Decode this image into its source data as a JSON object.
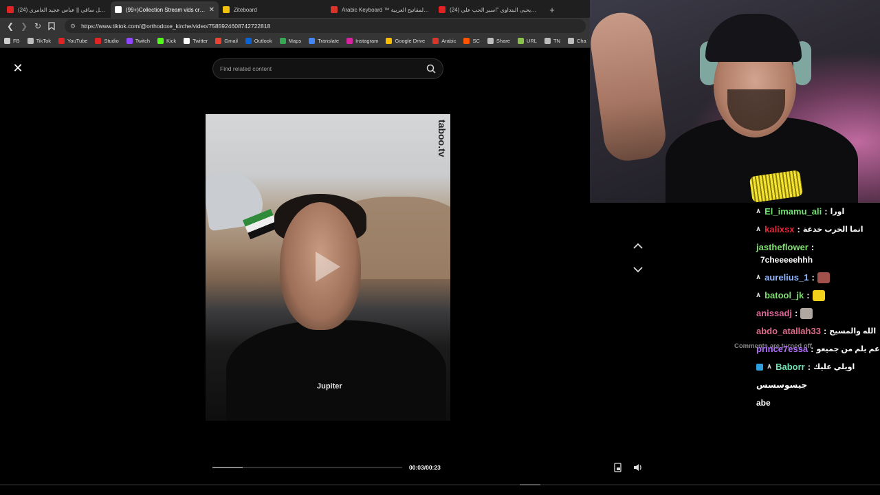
{
  "browser": {
    "tabs": [
      {
        "title": "(24) اجمل ساقي || عباس عجيد العامري",
        "favicon_color": "#e02424",
        "active": false
      },
      {
        "title": "(99+)Collection Stream vids creator",
        "favicon_color": "#ffffff",
        "active": true,
        "close": "✕"
      },
      {
        "title": "Ziteboard",
        "favicon_color": "#f2c10f",
        "active": false
      },
      {
        "title": "Arabic Keyboard ™ لوحة المفاتيح العربية",
        "favicon_color": "#d9362b",
        "active": false
      },
      {
        "title": "(24) يحيى البنداوي \"اسير الحب علي\" #...",
        "favicon_color": "#e02424",
        "active": false
      }
    ],
    "new_tab": "+",
    "url": "https://www.tiktok.com/@orthodoxe_kirche/video/7585924608742722818",
    "bookmarks": [
      {
        "label": "FB",
        "color": "#cfcfcf"
      },
      {
        "label": "TikTok",
        "color": "#bdbdbd"
      },
      {
        "label": "YouTube",
        "color": "#e02424"
      },
      {
        "label": "Studio",
        "color": "#e02424"
      },
      {
        "label": "Twitch",
        "color": "#9146ff"
      },
      {
        "label": "Kick",
        "color": "#53fc18"
      },
      {
        "label": "Twitter",
        "color": "#ffffff"
      },
      {
        "label": "Gmail",
        "color": "#ea4335"
      },
      {
        "label": "Outlook",
        "color": "#0a64d6"
      },
      {
        "label": "Maps",
        "color": "#34a853"
      },
      {
        "label": "Translate",
        "color": "#4285f4"
      },
      {
        "label": "Instagram",
        "color": "#d6249f"
      },
      {
        "label": "Google Drive",
        "color": "#fbbc04"
      },
      {
        "label": "Arabic",
        "color": "#d9362b"
      },
      {
        "label": "SC",
        "color": "#ff5500"
      },
      {
        "label": "Share",
        "color": "#bdbdbd"
      },
      {
        "label": "URL",
        "color": "#8bc34a"
      },
      {
        "label": "TN",
        "color": "#bdbdbd"
      },
      {
        "label": "Cha",
        "color": "#bdbdbd"
      }
    ]
  },
  "tiktok": {
    "close": "✕",
    "search_placeholder": "Find related content",
    "watermark": "taboo.tv",
    "shirt_text": "Jupiter",
    "time": "00:03/00:23",
    "progress": 0.16
  },
  "chat": {
    "messages": [
      {
        "badge": "٨",
        "user": "El_imamu_ali",
        "color": "#6fe36f",
        "text": "اورا"
      },
      {
        "badge": "٨",
        "user": "kalixsx",
        "color": "#e0283a",
        "text": "انما الخرب خدعة"
      },
      {
        "badge": "",
        "user": "jastheflower",
        "color": "#7ee06f",
        "text": "7cheeeeehhh",
        "wrap": true
      },
      {
        "badge": "٨",
        "user": "aurelius_1",
        "color": "#8fb6ff",
        "text": "",
        "emote": "#a0524a"
      },
      {
        "badge": "٨",
        "user": "batool_jk",
        "color": "#7ee06f",
        "text": "",
        "emote": "#f2d21b"
      },
      {
        "badge": "",
        "user": "anissadj",
        "color": "#e06a9a",
        "text": "",
        "emote": "#b0a8a0"
      },
      {
        "badge": "",
        "user": "abdo_atallah33",
        "color": "#e06a8a",
        "text": "الله والمسيح"
      },
      {
        "badge": "",
        "user": "prince7essa",
        "color": "#b370ff",
        "text": "عم يلم من جميعو"
      },
      {
        "badge": "٨",
        "user": "Baborr",
        "color": "#6fe3b5",
        "text": "اويلي عليك",
        "cube": true
      },
      {
        "badge": "",
        "user": "",
        "color": "#ffffff",
        "text": "جيسوسسس",
        "wrap": true
      },
      {
        "badge": "",
        "user": "",
        "color": "#ffffff",
        "text": "abe",
        "wrap": true
      }
    ],
    "comments_off": "Comments are turned off"
  }
}
